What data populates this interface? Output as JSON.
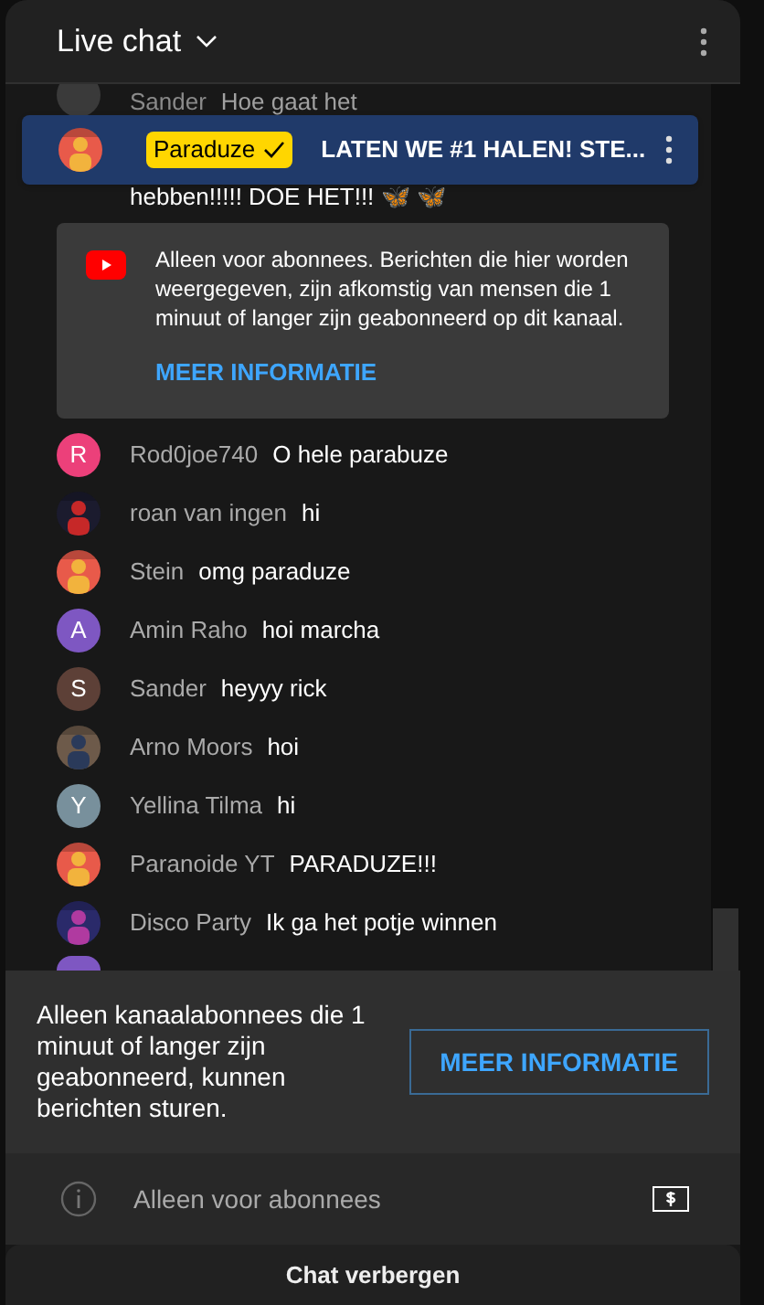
{
  "header": {
    "title": "Live chat"
  },
  "pinned": {
    "author": "Paraduze",
    "message": "LATEN WE #1 HALEN! STE..."
  },
  "partial_messages": [
    {
      "author": "Sander",
      "message": "Hoe gaat het"
    },
    {
      "message": "hebben!!!!! DOE HET!!! 🦋 🦋"
    }
  ],
  "notice": {
    "text": "Alleen voor abonnees. Berichten die hier worden weergegeven, zijn afkomstig van mensen die 1 minuut of langer zijn geabonneerd op dit kanaal.",
    "link": "MEER INFORMATIE"
  },
  "messages": [
    {
      "author": "Rod0joe740",
      "message": "O hele parabuze",
      "avatar": {
        "kind": "letter",
        "letter": "R",
        "color": "#ec407a"
      }
    },
    {
      "author": "roan van ingen",
      "message": "hi"
    },
    {
      "author": "Stein",
      "message": "omg paraduze"
    },
    {
      "author": "Amin Raho",
      "message": "hoi marcha",
      "avatar": {
        "kind": "letter",
        "letter": "A",
        "color": "#7e57c2"
      }
    },
    {
      "author": "Sander",
      "message": "heyyy rick",
      "avatar": {
        "kind": "letter",
        "letter": "S",
        "color": "#5d4037"
      }
    },
    {
      "author": "Arno Moors",
      "message": "hoi"
    },
    {
      "author": "Yellina Tilma",
      "message": "hi",
      "avatar": {
        "kind": "letter",
        "letter": "Y",
        "color": "#78909c"
      }
    },
    {
      "author": "Paranoide YT",
      "message": "PARADUZE!!!"
    },
    {
      "author": "Disco Party",
      "message": "Ik ga het potje winnen"
    }
  ],
  "restriction": {
    "text": "Alleen kanaalabonnees die 1 minuut of langer zijn geabonneerd, kunnen berichten sturen.",
    "button": "MEER INFORMATIE"
  },
  "input": {
    "placeholder": "Alleen voor abonnees"
  },
  "hide_button": "Chat verbergen"
}
